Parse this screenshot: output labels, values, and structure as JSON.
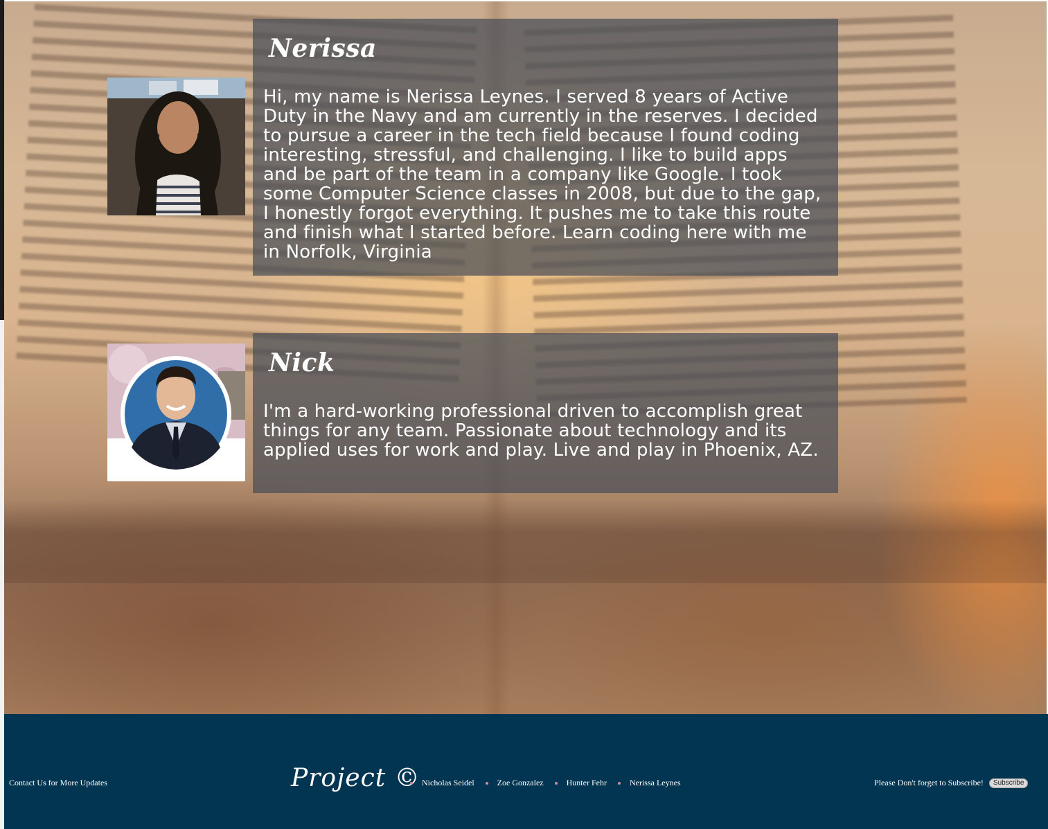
{
  "members": [
    {
      "name": "Nerissa",
      "bio": "Hi, my name is Nerissa Leynes. I served 8 years of Active Duty in the Navy and am currently in the reserves. I decided to pursue a career in the tech field because I found coding interesting, stressful, and challenging. I like to build apps and be part of the team in a company like Google. I took some Computer Science classes in 2008, but due to the gap, I honestly forgot everything. It pushes me to take this route and finish what I started before. Learn coding here with me in Norfolk, Virginia"
    },
    {
      "name": "Nick",
      "bio": "I'm a hard-working professional driven to accomplish great things for any team. Passionate about technology and its applied uses for work and play. Live and play in Phoenix, AZ."
    }
  ],
  "footer": {
    "contact": "Contact Us for More Updates",
    "logo": "Project ©",
    "nav": [
      "Nicholas Seidel",
      "Zoe Gonzalez",
      "Hunter Fehr",
      "Nerissa Leynes"
    ],
    "subscribe_prompt": "Please Don't forget to Subscribe!",
    "subscribe_button": "Subscribe"
  },
  "colors": {
    "footer_bg": "#023552",
    "card_bg": "rgba(72,78,88,0.72)",
    "nav_dot": "#d08aa0"
  }
}
